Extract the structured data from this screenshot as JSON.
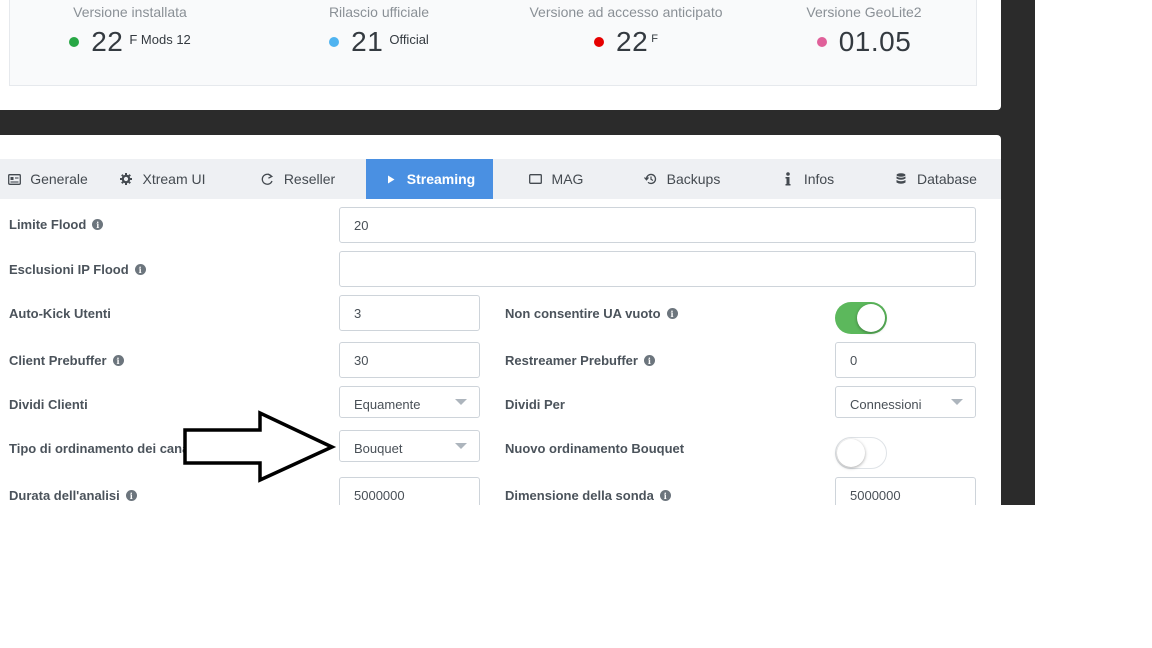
{
  "versions": [
    {
      "label": "Versione installata",
      "value": "22",
      "suffix": "F Mods 12",
      "dot_color": "#28a745"
    },
    {
      "label": "Rilascio ufficiale",
      "value": "21",
      "suffix": "Official",
      "dot_color": "#4fb3f0"
    },
    {
      "label": "Versione ad accesso anticipato",
      "value": "22",
      "suffix": "F",
      "dot_color": "#e60000"
    },
    {
      "label": "Versione GeoLite2",
      "value": "01.05",
      "suffix": "",
      "dot_color": "#e0609a"
    }
  ],
  "tabs": [
    {
      "label": "Generale",
      "icon": "id-card-icon"
    },
    {
      "label": "Xtream UI",
      "icon": "gear-icon"
    },
    {
      "label": "Reseller",
      "icon": "refresh-icon"
    },
    {
      "label": "Streaming",
      "icon": "play-icon",
      "active": true
    },
    {
      "label": "MAG",
      "icon": "tv-icon"
    },
    {
      "label": "Backups",
      "icon": "history-icon"
    },
    {
      "label": "Infos",
      "icon": "info-icon"
    },
    {
      "label": "Database",
      "icon": "database-icon"
    }
  ],
  "form": {
    "limite_flood": {
      "label": "Limite Flood",
      "value": "20"
    },
    "esclusioni_ip_flood": {
      "label": "Esclusioni IP Flood",
      "value": ""
    },
    "auto_kick": {
      "label": "Auto-Kick Utenti",
      "value": "3"
    },
    "non_consentire_ua": {
      "label": "Non consentire UA vuoto",
      "enabled": true
    },
    "client_prebuffer": {
      "label": "Client Prebuffer",
      "value": "30"
    },
    "restreamer_prebuffer": {
      "label": "Restreamer Prebuffer",
      "value": "0"
    },
    "dividi_clienti": {
      "label": "Dividi Clienti",
      "value": "Equamente"
    },
    "dividi_per": {
      "label": "Dividi Per",
      "value": "Connessioni"
    },
    "tipo_ordinamento": {
      "label": "Tipo di ordinamento dei canali",
      "value": "Bouquet"
    },
    "nuovo_ordinamento": {
      "label": "Nuovo ordinamento Bouquet",
      "enabled": false
    },
    "durata_analisi": {
      "label": "Durata dell'analisi",
      "value": "5000000"
    },
    "dimensione_sonda": {
      "label": "Dimensione della sonda",
      "value": "5000000"
    }
  },
  "colors": {
    "accent": "#4a90e2",
    "toggle_on": "#5cb85c",
    "backdrop": "#2b2b2b"
  }
}
